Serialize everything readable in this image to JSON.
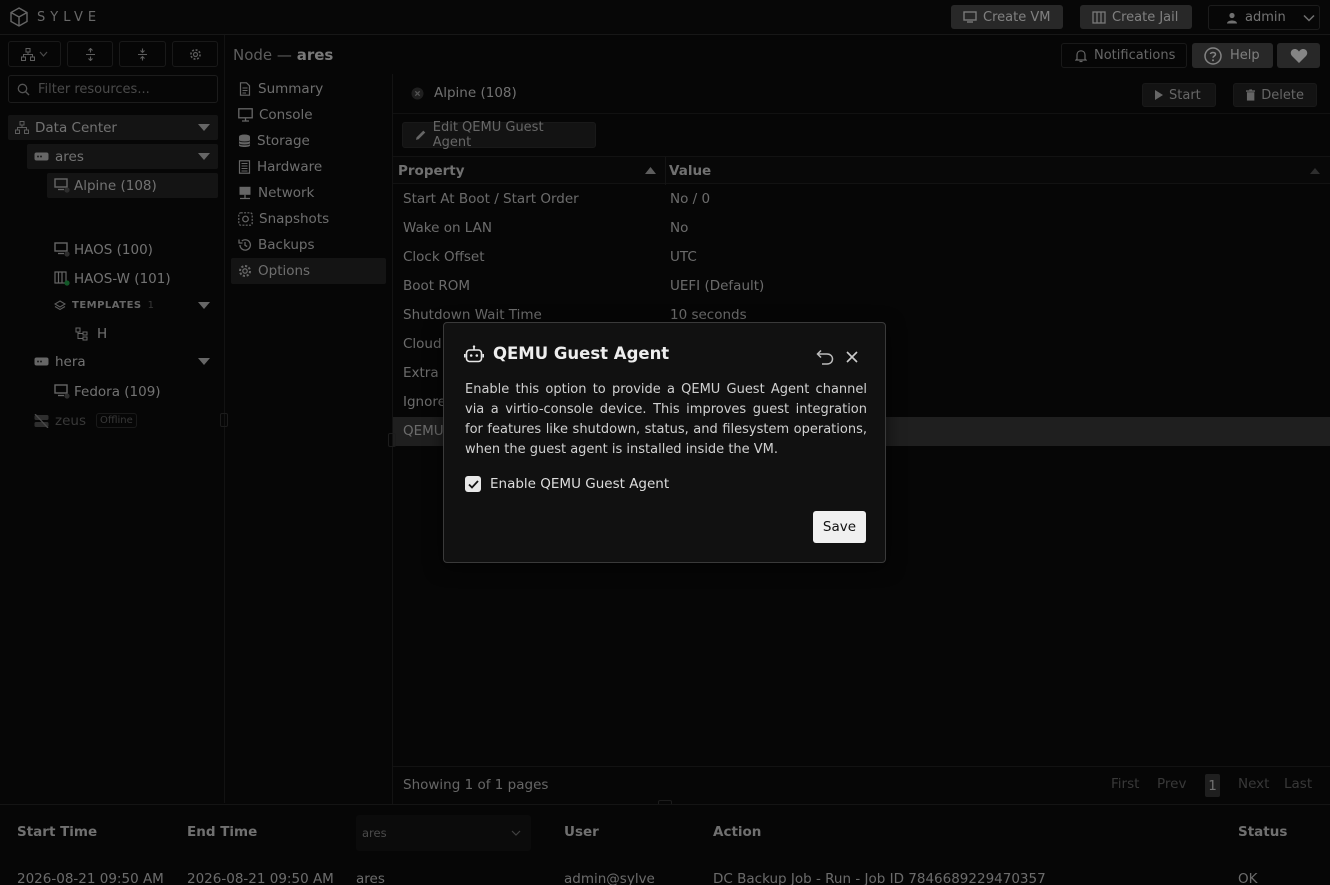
{
  "app": {
    "brand": "SYLVE"
  },
  "header": {
    "create_vm": "Create VM",
    "create_jail": "Create Jail",
    "user": "admin",
    "notifications": "Notifications",
    "help": "Help"
  },
  "sidebar": {
    "filter_placeholder": "Filter resources...",
    "datacenter": "Data Center",
    "nodes": [
      {
        "name": "ares"
      },
      {
        "name": "hera"
      },
      {
        "name": "zeus",
        "badge": "Offline"
      }
    ],
    "ares_items": [
      "Alpine (108)",
      "HAOS (100)",
      "HAOS-W (101)"
    ],
    "templates_label": "TEMPLATES",
    "templates_count": "1",
    "template_item": "H",
    "hera_items": [
      "Fedora (109)"
    ]
  },
  "node": {
    "prefix": "Node —",
    "name": "ares"
  },
  "nav": [
    "Summary",
    "Console",
    "Storage",
    "Hardware",
    "Network",
    "Snapshots",
    "Backups",
    "Options"
  ],
  "tab": {
    "label": "Alpine (108)",
    "start": "Start",
    "delete": "Delete"
  },
  "toolbar": {
    "edit": "Edit QEMU Guest Agent"
  },
  "grid": {
    "headers": [
      "Property",
      "Value"
    ],
    "rows": [
      [
        "Start At Boot / Start Order",
        "No / 0"
      ],
      [
        "Wake on LAN",
        "No"
      ],
      [
        "Clock Offset",
        "UTC"
      ],
      [
        "Boot ROM",
        "UEFI (Default)"
      ],
      [
        "Shutdown Wait Time",
        "10 seconds"
      ],
      [
        "Cloud",
        ""
      ],
      [
        "Extra B",
        ""
      ],
      [
        "Ignore",
        ""
      ],
      [
        "QEMU",
        ""
      ]
    ],
    "footer": "Showing 1 of 1 pages",
    "pager": {
      "first": "First",
      "prev": "Prev",
      "page": "1",
      "next": "Next",
      "last": "Last"
    }
  },
  "tasks": {
    "headers": [
      "Start Time",
      "End Time",
      "User",
      "Action",
      "Status"
    ],
    "node_select": "ares",
    "row": [
      "2026-08-21 09:50 AM",
      "2026-08-21 09:50 AM",
      "ares",
      "admin@sylve",
      "DC Backup Job - Run - Job ID 7846689229470357",
      "OK"
    ]
  },
  "dialog": {
    "title": "QEMU Guest Agent",
    "description": "Enable this option to provide a QEMU Guest Agent channel via a virtio-console device. This improves guest integration for features like shutdown, status, and filesystem operations, when the guest agent is installed inside the VM.",
    "checkbox_label": "Enable QEMU Guest Agent",
    "checked": true,
    "save": "Save"
  }
}
